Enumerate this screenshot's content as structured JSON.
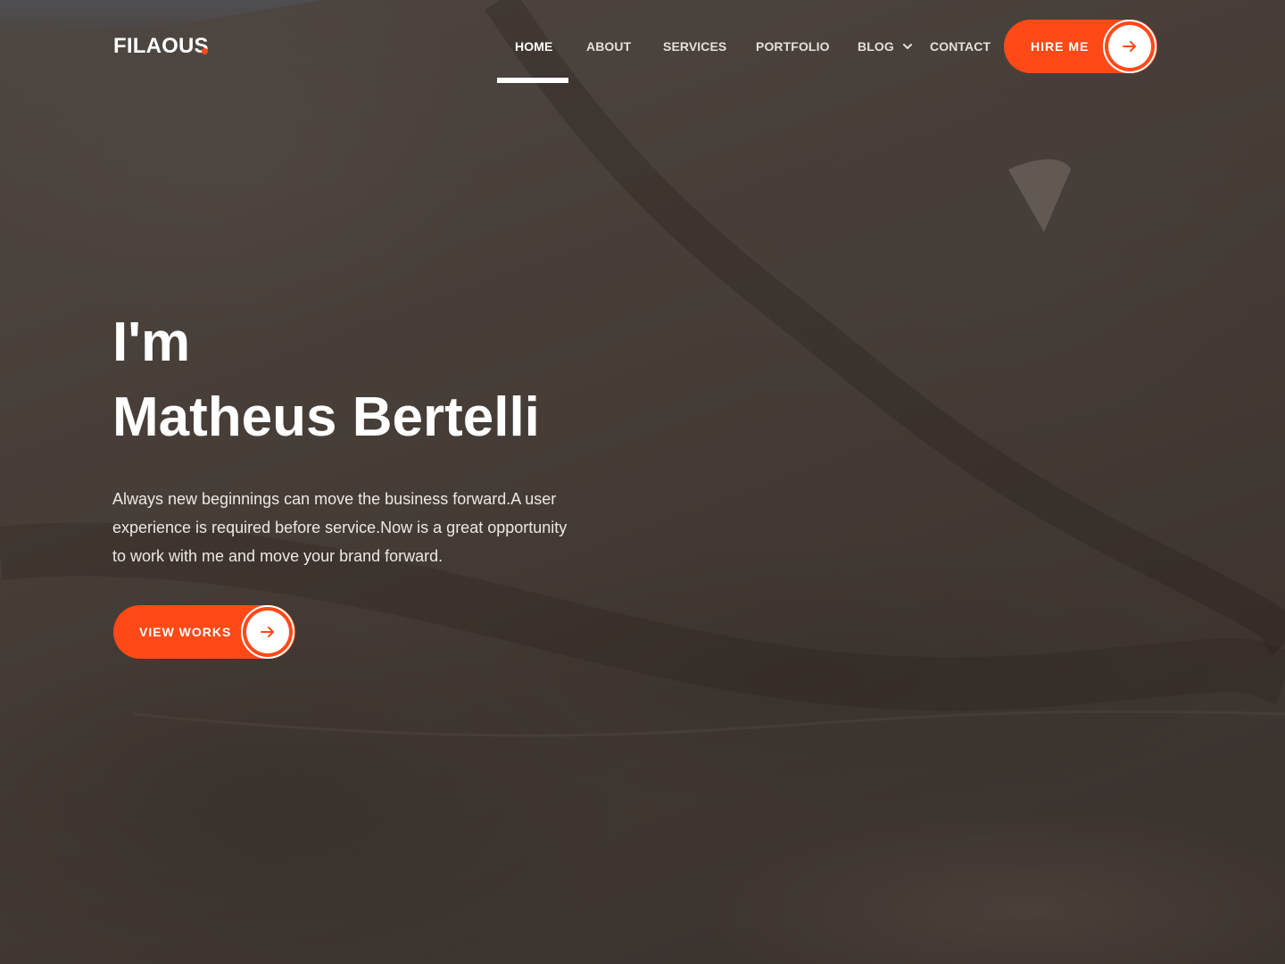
{
  "brand": {
    "name": "FILAOUS",
    "accent_color": "#ff4a17"
  },
  "nav": {
    "items": [
      {
        "label": "HOME",
        "active": true
      },
      {
        "label": "ABOUT"
      },
      {
        "label": "SERVICES"
      },
      {
        "label": "PORTFOLIO"
      },
      {
        "label": "BLOG",
        "has_dropdown": true
      },
      {
        "label": "CONTACT"
      }
    ],
    "dropdown_icon": "chevron-down-icon"
  },
  "header_cta": {
    "label": "HIRE ME",
    "icon": "arrow-right-icon"
  },
  "hero": {
    "greeting": "I'm",
    "name": "Matheus Bertelli",
    "description": "Always new beginnings can move the business forward.A user experience is required before service.Now is a great opportunity to work with me and move your brand forward.",
    "cta": {
      "label": "VIEW WORKS",
      "icon": "arrow-right-icon"
    }
  }
}
